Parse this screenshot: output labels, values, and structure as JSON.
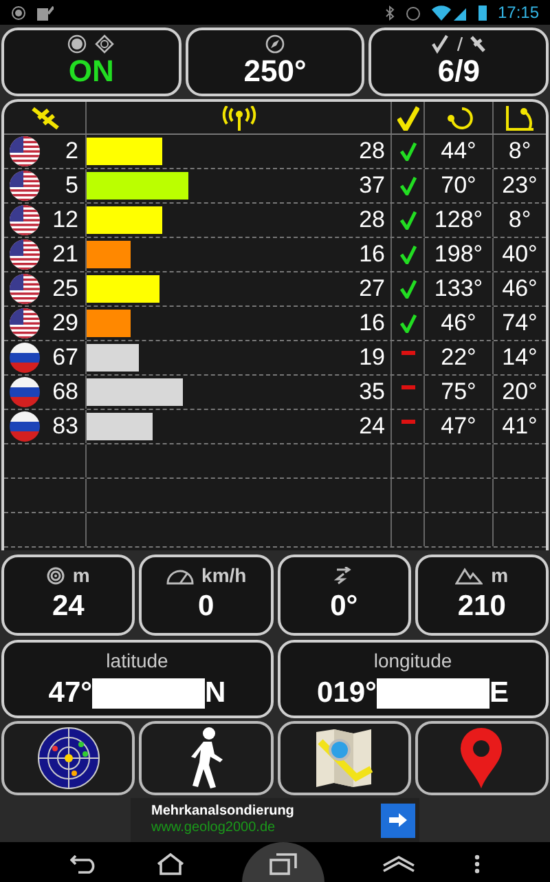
{
  "status_bar": {
    "time": "17:15"
  },
  "top_cards": [
    {
      "kind": "fix",
      "value": "ON"
    },
    {
      "kind": "heading",
      "value": "250°"
    },
    {
      "kind": "sats",
      "value": "6/9"
    }
  ],
  "satellites": [
    {
      "kind": "us",
      "id": "2",
      "level": 0.25,
      "color": "#ffff00",
      "snr": "28",
      "used": true,
      "azimuth": "44°",
      "elevation": "8°"
    },
    {
      "kind": "us",
      "id": "5",
      "level": 0.335,
      "color": "#bbff00",
      "snr": "37",
      "used": true,
      "azimuth": "70°",
      "elevation": "23°"
    },
    {
      "kind": "us",
      "id": "12",
      "level": 0.25,
      "color": "#ffff00",
      "snr": "28",
      "used": true,
      "azimuth": "128°",
      "elevation": "8°"
    },
    {
      "kind": "us",
      "id": "21",
      "level": 0.145,
      "color": "#ff8800",
      "snr": "16",
      "used": true,
      "azimuth": "198°",
      "elevation": "40°"
    },
    {
      "kind": "us",
      "id": "25",
      "level": 0.24,
      "color": "#ffff00",
      "snr": "27",
      "used": true,
      "azimuth": "133°",
      "elevation": "46°"
    },
    {
      "kind": "us",
      "id": "29",
      "level": 0.145,
      "color": "#ff8800",
      "snr": "16",
      "used": true,
      "azimuth": "46°",
      "elevation": "74°"
    },
    {
      "kind": "ru",
      "id": "67",
      "level": 0.17,
      "color": "#d8d8d8",
      "snr": "19",
      "used": false,
      "azimuth": "22°",
      "elevation": "14°"
    },
    {
      "kind": "ru",
      "id": "68",
      "level": 0.315,
      "color": "#d8d8d8",
      "snr": "35",
      "used": false,
      "azimuth": "75°",
      "elevation": "20°"
    },
    {
      "kind": "ru",
      "id": "83",
      "level": 0.215,
      "color": "#d8d8d8",
      "snr": "24",
      "used": false,
      "azimuth": "47°",
      "elevation": "41°"
    }
  ],
  "info_cards": [
    {
      "kind": "accuracy",
      "unit": "m",
      "value": "24"
    },
    {
      "kind": "speed",
      "unit": "km/h",
      "value": "0"
    },
    {
      "kind": "bearing",
      "value": "0°"
    },
    {
      "kind": "altitude",
      "unit": "m",
      "value": "210"
    }
  ],
  "coordinates": [
    {
      "label": "latitude",
      "start": "47°",
      "end": "N"
    },
    {
      "label": "longitude",
      "start": "019°",
      "end": "E"
    }
  ],
  "buttons": [
    {
      "kind": "radar"
    },
    {
      "kind": "walk"
    },
    {
      "kind": "map"
    },
    {
      "kind": "pin"
    }
  ],
  "ad": {
    "title": "Mehrkanalsondierung",
    "url": "www.geolog2000.de"
  }
}
